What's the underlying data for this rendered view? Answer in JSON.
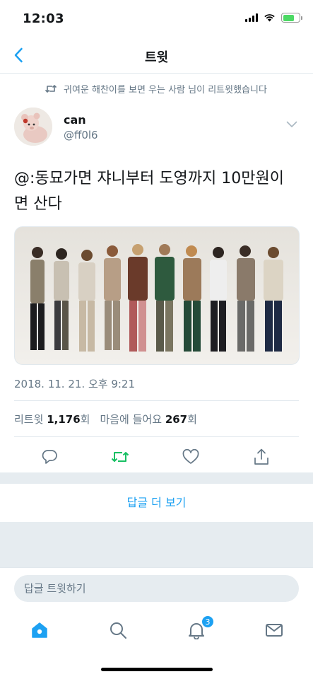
{
  "status_bar": {
    "time": "12:03"
  },
  "header": {
    "title": "트윗"
  },
  "retweet_context": "귀여운 해찬이를 보면 우는 사람 님이 리트윗했습니다",
  "author": {
    "name": "can",
    "handle": "@ff0l6"
  },
  "tweet": {
    "text": "@:동묘가면 쟈니부터 도영까지 10만원이면 산다",
    "timestamp": "2018. 11. 21. 오후 9:21",
    "retweets_label": "리트윗",
    "retweets_count": "1,176",
    "retweets_unit": "회",
    "likes_label": "마음에 들어요",
    "likes_count": "267",
    "likes_unit": "회"
  },
  "more_replies": "답글 더 보기",
  "reply_bar": {
    "placeholder": "답글 트윗하기"
  },
  "tab_bar": {
    "notifications_badge": "3"
  },
  "colors": {
    "accent": "#1da1f2",
    "retweet_green": "#17bf63",
    "muted": "#657786",
    "divider": "#e6ecf0"
  },
  "icons": [
    "back-chevron-icon",
    "retweet-icon",
    "caret-down-icon",
    "reply-icon",
    "retweet-icon",
    "like-icon",
    "share-icon",
    "home-icon",
    "search-icon",
    "notifications-icon",
    "messages-icon"
  ]
}
